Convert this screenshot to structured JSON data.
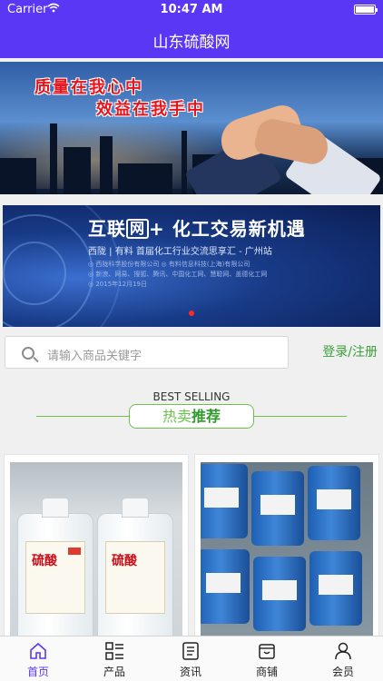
{
  "status_bar": {
    "carrier": "Carrier",
    "time": "10:47 AM"
  },
  "nav": {
    "title": "山东硫酸网"
  },
  "banner1": {
    "line1": "质量在我心中",
    "line2": "效益在我手中"
  },
  "banner2": {
    "headline_pre": "互联",
    "headline_box": "网",
    "headline_post": "+ 化工交易新机遇",
    "subline": "西陇 | 有料  首届化工行业交流思享汇 - 广州站",
    "details": [
      "◎ 西陇科学股份有限公司  ◎ 有料信息科技(上海)有限公司",
      "◎ 新浪、网易、搜狐、腾讯、中国化工网、慧聪网、盖德化工网",
      "◎ 2015年12月19日"
    ],
    "carousel_active_color": "#ff2a2a"
  },
  "search": {
    "placeholder": "请输入商品关键字",
    "login_label": "登录/注册"
  },
  "best_selling": {
    "english": "BEST SELLING",
    "title_a": "热卖",
    "title_b": "推荐"
  },
  "products": [
    {
      "label": "硫酸",
      "label2": "硫酸"
    },
    {
      "label": ""
    }
  ],
  "tabs": [
    {
      "label": "首页",
      "icon": "home-icon",
      "active": true
    },
    {
      "label": "产品",
      "icon": "grid-list-icon",
      "active": false
    },
    {
      "label": "资讯",
      "icon": "news-icon",
      "active": false
    },
    {
      "label": "商铺",
      "icon": "shop-icon",
      "active": false
    },
    {
      "label": "会员",
      "icon": "user-icon",
      "active": false
    }
  ],
  "colors": {
    "nav": "#5a37f5",
    "accent_green": "#3aa038",
    "active_tab": "#5a37f5"
  }
}
